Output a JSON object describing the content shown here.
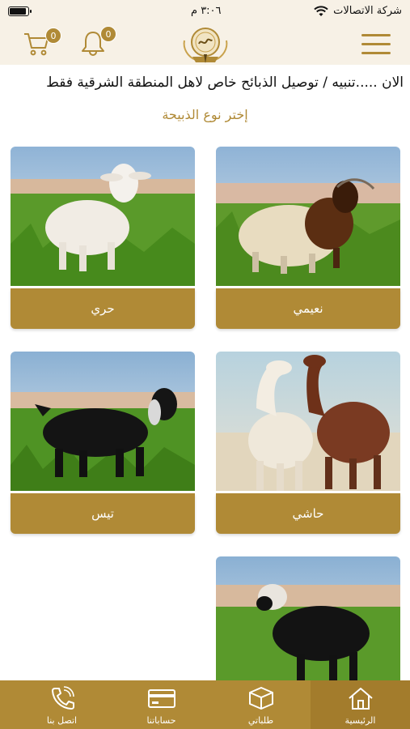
{
  "status": {
    "carrier": "شركة الاتصالات",
    "time": "٣:٠٦ م",
    "battery_level": 0.9
  },
  "header": {
    "cart_count": "0",
    "notification_count": "0"
  },
  "marquee": "الان .....تنبيه / توصيل الذبائح خاص لاهل المنطقة الشرقية فقط",
  "section_title": "إختر نوع الذبيحة",
  "categories": [
    {
      "label": "نعيمي",
      "icon": "naeemi-sheep-photo"
    },
    {
      "label": "حري",
      "icon": "harri-sheep-photo"
    },
    {
      "label": "حاشي",
      "icon": "hashi-camel-photo"
    },
    {
      "label": "تيس",
      "icon": "goat-photo"
    },
    {
      "label": "",
      "icon": "najdi-sheep-photo"
    }
  ],
  "nav": {
    "home": "الرئيسية",
    "orders": "طلباتي",
    "accounts": "حساباتنا",
    "contact": "اتصل بنا"
  },
  "colors": {
    "accent": "#b08a36",
    "header_bg": "#f7f1e6"
  }
}
